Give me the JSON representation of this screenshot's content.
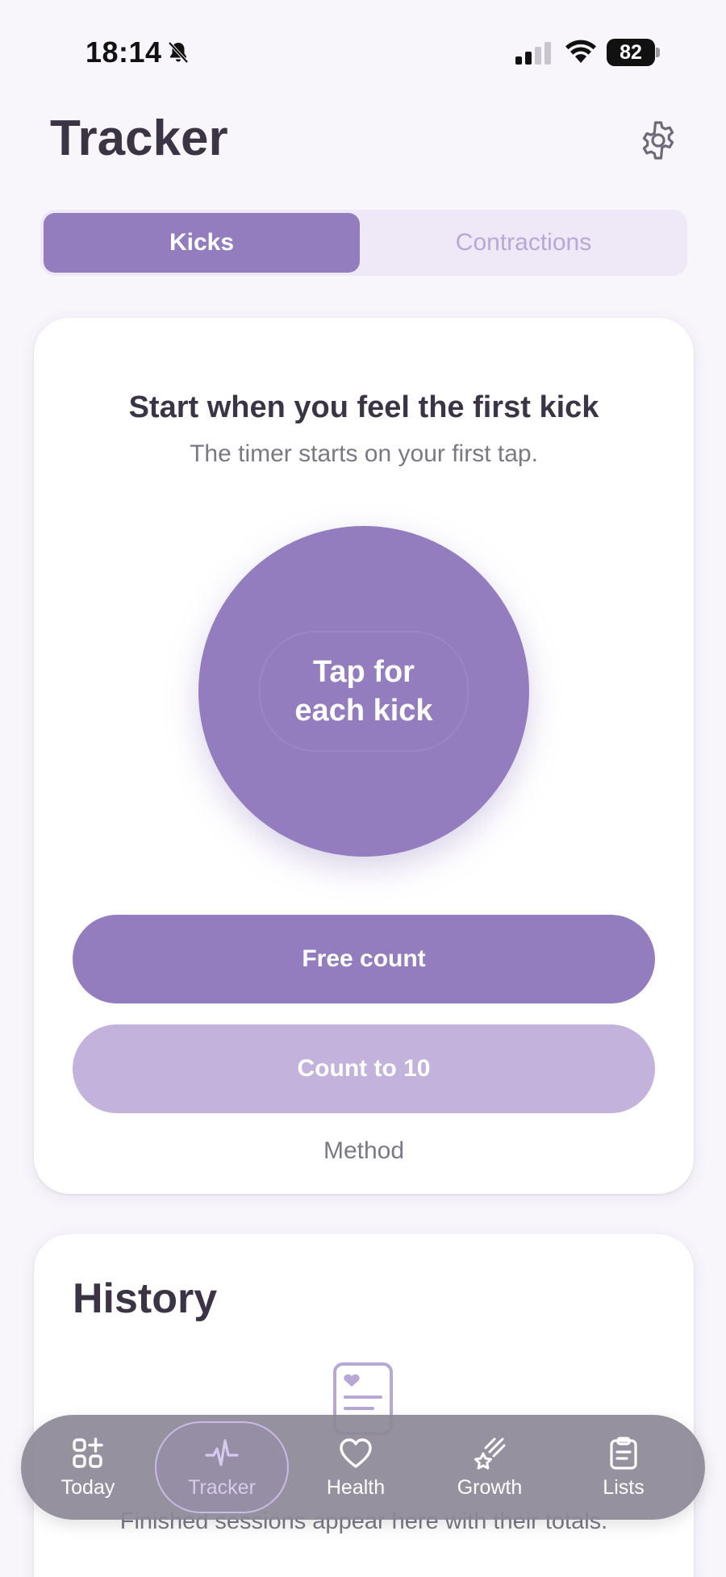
{
  "status_bar": {
    "time": "18:14",
    "battery": "82"
  },
  "header": {
    "title": "Tracker"
  },
  "segmented": {
    "tabs": [
      "Kicks",
      "Contractions"
    ],
    "selected": "Kicks"
  },
  "kick_card": {
    "heading": "Start when you feel the first kick",
    "subtitle": "The timer starts on your first tap.",
    "tap_button": "Tap for\neach kick",
    "methods": [
      "Free count",
      "Count to 10"
    ],
    "method_label": "Method"
  },
  "history": {
    "title": "History",
    "empty_text": "Finished sessions appear here with their totals."
  },
  "tab_bar": {
    "items": [
      {
        "label": "Today",
        "icon": "grid-plus-icon"
      },
      {
        "label": "Tracker",
        "icon": "pulse-icon"
      },
      {
        "label": "Health",
        "icon": "heart-icon"
      },
      {
        "label": "Growth",
        "icon": "shooting-star-icon"
      },
      {
        "label": "Lists",
        "icon": "clipboard-icon"
      }
    ],
    "active": "Tracker"
  },
  "colors": {
    "accent": "#937dbe",
    "accent_light": "#c3b2dc",
    "background": "#f8f6fb",
    "text": "#3a3445"
  }
}
